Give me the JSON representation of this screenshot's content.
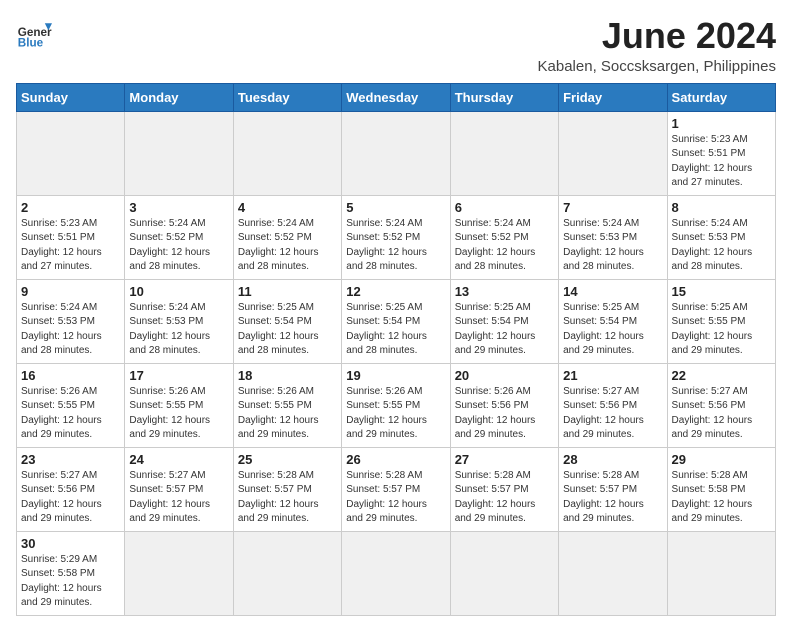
{
  "header": {
    "logo_general": "General",
    "logo_blue": "Blue",
    "month_title": "June 2024",
    "location": "Kabalen, Soccsksargen, Philippines"
  },
  "days_of_week": [
    "Sunday",
    "Monday",
    "Tuesday",
    "Wednesday",
    "Thursday",
    "Friday",
    "Saturday"
  ],
  "weeks": [
    [
      {
        "day": "",
        "info": ""
      },
      {
        "day": "",
        "info": ""
      },
      {
        "day": "",
        "info": ""
      },
      {
        "day": "",
        "info": ""
      },
      {
        "day": "",
        "info": ""
      },
      {
        "day": "",
        "info": ""
      },
      {
        "day": "1",
        "info": "Sunrise: 5:23 AM\nSunset: 5:51 PM\nDaylight: 12 hours and 27 minutes."
      }
    ],
    [
      {
        "day": "2",
        "info": "Sunrise: 5:23 AM\nSunset: 5:51 PM\nDaylight: 12 hours and 27 minutes."
      },
      {
        "day": "3",
        "info": "Sunrise: 5:24 AM\nSunset: 5:52 PM\nDaylight: 12 hours and 28 minutes."
      },
      {
        "day": "4",
        "info": "Sunrise: 5:24 AM\nSunset: 5:52 PM\nDaylight: 12 hours and 28 minutes."
      },
      {
        "day": "5",
        "info": "Sunrise: 5:24 AM\nSunset: 5:52 PM\nDaylight: 12 hours and 28 minutes."
      },
      {
        "day": "6",
        "info": "Sunrise: 5:24 AM\nSunset: 5:52 PM\nDaylight: 12 hours and 28 minutes."
      },
      {
        "day": "7",
        "info": "Sunrise: 5:24 AM\nSunset: 5:53 PM\nDaylight: 12 hours and 28 minutes."
      },
      {
        "day": "8",
        "info": "Sunrise: 5:24 AM\nSunset: 5:53 PM\nDaylight: 12 hours and 28 minutes."
      }
    ],
    [
      {
        "day": "9",
        "info": "Sunrise: 5:24 AM\nSunset: 5:53 PM\nDaylight: 12 hours and 28 minutes."
      },
      {
        "day": "10",
        "info": "Sunrise: 5:24 AM\nSunset: 5:53 PM\nDaylight: 12 hours and 28 minutes."
      },
      {
        "day": "11",
        "info": "Sunrise: 5:25 AM\nSunset: 5:54 PM\nDaylight: 12 hours and 28 minutes."
      },
      {
        "day": "12",
        "info": "Sunrise: 5:25 AM\nSunset: 5:54 PM\nDaylight: 12 hours and 28 minutes."
      },
      {
        "day": "13",
        "info": "Sunrise: 5:25 AM\nSunset: 5:54 PM\nDaylight: 12 hours and 29 minutes."
      },
      {
        "day": "14",
        "info": "Sunrise: 5:25 AM\nSunset: 5:54 PM\nDaylight: 12 hours and 29 minutes."
      },
      {
        "day": "15",
        "info": "Sunrise: 5:25 AM\nSunset: 5:55 PM\nDaylight: 12 hours and 29 minutes."
      }
    ],
    [
      {
        "day": "16",
        "info": "Sunrise: 5:26 AM\nSunset: 5:55 PM\nDaylight: 12 hours and 29 minutes."
      },
      {
        "day": "17",
        "info": "Sunrise: 5:26 AM\nSunset: 5:55 PM\nDaylight: 12 hours and 29 minutes."
      },
      {
        "day": "18",
        "info": "Sunrise: 5:26 AM\nSunset: 5:55 PM\nDaylight: 12 hours and 29 minutes."
      },
      {
        "day": "19",
        "info": "Sunrise: 5:26 AM\nSunset: 5:55 PM\nDaylight: 12 hours and 29 minutes."
      },
      {
        "day": "20",
        "info": "Sunrise: 5:26 AM\nSunset: 5:56 PM\nDaylight: 12 hours and 29 minutes."
      },
      {
        "day": "21",
        "info": "Sunrise: 5:27 AM\nSunset: 5:56 PM\nDaylight: 12 hours and 29 minutes."
      },
      {
        "day": "22",
        "info": "Sunrise: 5:27 AM\nSunset: 5:56 PM\nDaylight: 12 hours and 29 minutes."
      }
    ],
    [
      {
        "day": "23",
        "info": "Sunrise: 5:27 AM\nSunset: 5:56 PM\nDaylight: 12 hours and 29 minutes."
      },
      {
        "day": "24",
        "info": "Sunrise: 5:27 AM\nSunset: 5:57 PM\nDaylight: 12 hours and 29 minutes."
      },
      {
        "day": "25",
        "info": "Sunrise: 5:28 AM\nSunset: 5:57 PM\nDaylight: 12 hours and 29 minutes."
      },
      {
        "day": "26",
        "info": "Sunrise: 5:28 AM\nSunset: 5:57 PM\nDaylight: 12 hours and 29 minutes."
      },
      {
        "day": "27",
        "info": "Sunrise: 5:28 AM\nSunset: 5:57 PM\nDaylight: 12 hours and 29 minutes."
      },
      {
        "day": "28",
        "info": "Sunrise: 5:28 AM\nSunset: 5:57 PM\nDaylight: 12 hours and 29 minutes."
      },
      {
        "day": "29",
        "info": "Sunrise: 5:28 AM\nSunset: 5:58 PM\nDaylight: 12 hours and 29 minutes."
      }
    ],
    [
      {
        "day": "30",
        "info": "Sunrise: 5:29 AM\nSunset: 5:58 PM\nDaylight: 12 hours and 29 minutes."
      },
      {
        "day": "",
        "info": ""
      },
      {
        "day": "",
        "info": ""
      },
      {
        "day": "",
        "info": ""
      },
      {
        "day": "",
        "info": ""
      },
      {
        "day": "",
        "info": ""
      },
      {
        "day": "",
        "info": ""
      }
    ]
  ]
}
